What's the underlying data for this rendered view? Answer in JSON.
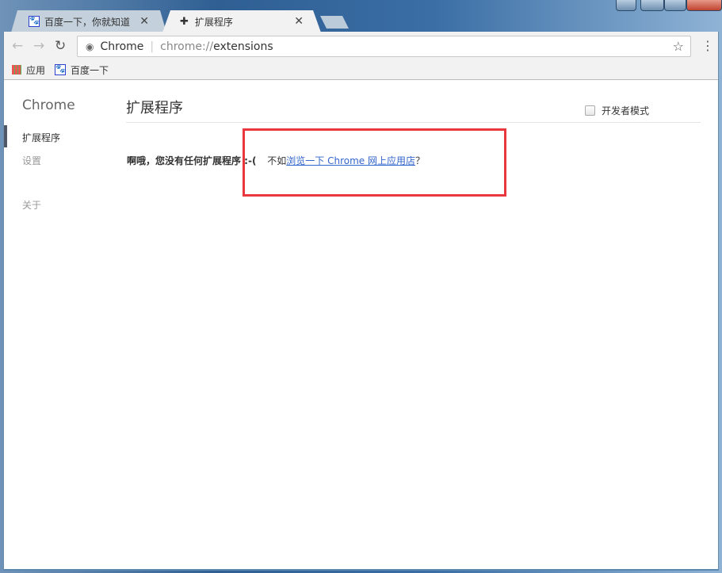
{
  "tabs": [
    {
      "title": "百度一下，你就知道",
      "icon": "baidu-paw-icon"
    },
    {
      "title": "扩展程序",
      "icon": "puzzle-icon",
      "active": true
    }
  ],
  "toolbar": {
    "site_label": "Chrome",
    "url_prefix": "chrome://",
    "url_path": "extensions"
  },
  "bookmarks": [
    {
      "label": "应用",
      "icon": "apps-grid-icon"
    },
    {
      "label": "百度一下",
      "icon": "baidu-paw-icon"
    }
  ],
  "sidebar": {
    "title": "Chrome",
    "items": [
      {
        "label": "扩展程序",
        "selected": true
      },
      {
        "label": "设置"
      },
      {
        "label": "关于"
      }
    ]
  },
  "main": {
    "title": "扩展程序",
    "dev_mode_label": "开发者模式",
    "dev_mode_checked": false,
    "empty_bold": "啊哦，您没有任何扩展程序 :-(",
    "empty_prefix": "不如",
    "empty_link": "浏览一下 Chrome 网上应用店",
    "empty_suffix": "？"
  },
  "colors": {
    "highlight_box": "#e8373d",
    "link": "#3366cc"
  }
}
